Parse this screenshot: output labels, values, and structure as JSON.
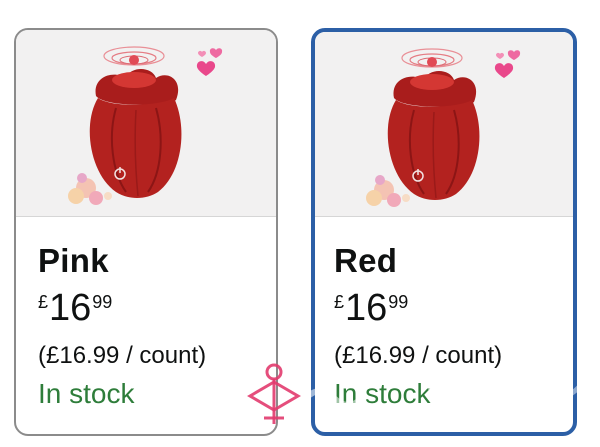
{
  "variants": [
    {
      "name": "Pink",
      "price": {
        "symbol": "£",
        "whole": "16",
        "fraction": "99"
      },
      "unit_price": "(£16.99 / count)",
      "availability": "In stock",
      "selected": false
    },
    {
      "name": "Red",
      "price": {
        "symbol": "£",
        "whole": "16",
        "fraction": "99"
      },
      "unit_price": "(£16.99 / count)",
      "availability": "In stock",
      "selected": true
    }
  ],
  "colors": {
    "selected_border": "#2c5fa6",
    "default_border": "#8b8b8b",
    "in_stock": "#2e7d3a",
    "product_red": "#b3221f"
  },
  "icons": {
    "product_image": "rose-product-image",
    "watermark": "watermark-icon"
  }
}
